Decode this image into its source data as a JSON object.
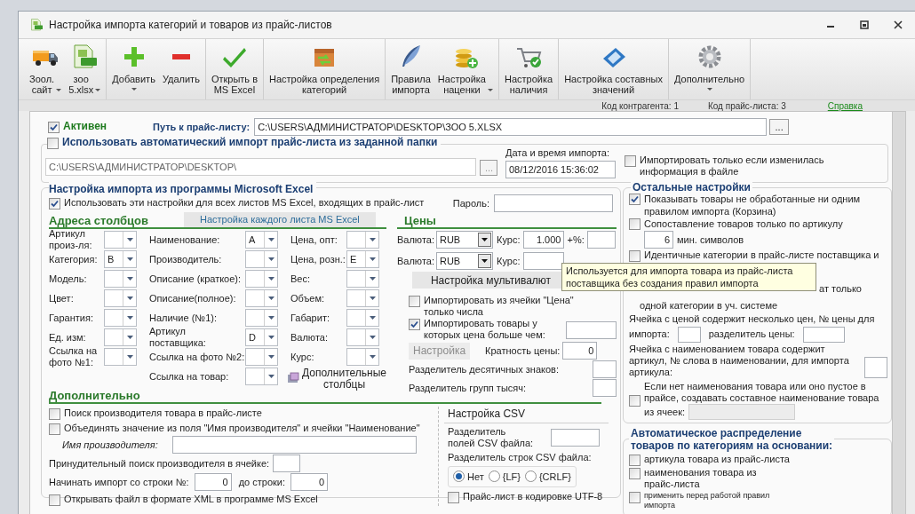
{
  "window": {
    "title": "Настройка импорта категорий и товаров из прайс-листов"
  },
  "toolbar": {
    "groups": [
      [
        {
          "kind": "truck",
          "label": "Зоол.\nсайт",
          "dropdown": true
        },
        {
          "kind": "xls",
          "label": "зоо\n5.xlsx",
          "dropdown": true
        }
      ],
      [
        {
          "kind": "plus",
          "label": "Добавить",
          "dropdown": true
        },
        {
          "kind": "minus",
          "label": "Удалить"
        }
      ],
      [
        {
          "kind": "check",
          "label": "Открыть в\nMS Excel"
        }
      ],
      [
        {
          "kind": "box",
          "label": "Настройка определения\nкатегорий"
        }
      ],
      [
        {
          "kind": "feather",
          "label": "Правила\nимпорта"
        },
        {
          "kind": "coins",
          "label": "Настройка\nнаценки",
          "dropdown": true
        }
      ],
      [
        {
          "kind": "cart",
          "label": "Настройка\nналичия"
        }
      ],
      [
        {
          "kind": "device",
          "label": "Настройка составных\nзначений"
        }
      ],
      [
        {
          "kind": "gear",
          "label": "Дополнительно",
          "dropdown": true
        }
      ]
    ]
  },
  "info": {
    "contractor_code": "Код контрагента: 1",
    "pricelist_code": "Код прайс-листа: 3",
    "help_link": "Справка"
  },
  "source": {
    "active": {
      "label": "Активен",
      "checked": true
    },
    "path_label": "Путь к прайс-листу:",
    "path": "C:\\USERS\\АДМИНИСТРАТОР\\DESKTOP\\ЗОО 5.XLSX",
    "browse": "...",
    "auto_import": {
      "label": "Использовать автоматический импорт прайс-листа из заданной папки",
      "checked": false
    },
    "folder": "C:\\USERS\\АДМИНИСТРАТОР\\DESKTOP\\",
    "folder_browse": "...",
    "date_label": "Дата и время импорта:",
    "date": "08/12/2016 15:36:02",
    "only_changed": {
      "label": "Импортировать только если изменилась информация в файле",
      "checked": false
    }
  },
  "excel": {
    "title": "Настройка импорта из программы Microsoft Excel",
    "use_all": {
      "label": "Использовать эти настройки для всех листов MS Excel, входящих в прайс-лист",
      "checked": true
    },
    "password_label": "Пароль:",
    "columns_heading": "Адреса столбцов",
    "sheet_button": "Настройка каждого листа MS Excel",
    "columns": [
      [
        {
          "label": "Артикул\nпроиз-ля:"
        },
        {
          "label": "Категория:",
          "value": "B"
        },
        {
          "label": "Модель:"
        },
        {
          "label": "Цвет:"
        },
        {
          "label": "Гарантия:"
        },
        {
          "label": "Ед. изм:"
        },
        {
          "label": "Ссылка на\nфото №1:"
        }
      ],
      [
        {
          "label": "Наименование:",
          "value": "A"
        },
        {
          "label": "Производитель:"
        },
        {
          "label": "Описание (краткое):"
        },
        {
          "label": "Описание(полное):"
        },
        {
          "label": "Наличие (№1):"
        },
        {
          "label": "Артикул\nпоставщика:",
          "value": "D"
        },
        {
          "label": "Ссылка на фото №2:"
        },
        {
          "label": "Ссылка на товар:"
        }
      ],
      [
        {
          "label": "Цена, опт:"
        },
        {
          "label": "Цена, розн.:",
          "value": "E"
        },
        {
          "label": "Вес:"
        },
        {
          "label": "Объем:"
        },
        {
          "label": "Габарит:"
        },
        {
          "label": "Валюта:"
        },
        {
          "label": "Курс:"
        }
      ]
    ],
    "extra_columns": "Дополнительные\nстолбцы",
    "prices": {
      "heading": "Цены",
      "currencies": [
        {
          "label": "Валюта:",
          "value": "RUB",
          "rate_label": "Курс:",
          "rate": "1.000",
          "markup_label": "+%:"
        },
        {
          "label": "Валюта:",
          "value": "RUB",
          "rate_label": "Курс:"
        }
      ],
      "multicurrency_button": "Настройка мультивалют",
      "numbers_only": {
        "label": "Импортировать из ячейки \"Цена\" только числа",
        "checked": false
      },
      "min_price": {
        "label": "Импортировать товары у которых цена больше чем:",
        "checked": true
      },
      "settings_button": {
        "label": "Настройка",
        "disabled": true
      },
      "multiplicity_label": "Кратность цены:",
      "multiplicity": "0",
      "decimal_separator_label": "Разделитель десятичных знаков:",
      "thousands_separator_label": "Разделитель групп тысяч:"
    }
  },
  "additional": {
    "heading": "Дополнительно",
    "find_manufacturer": {
      "label": "Поиск производителя товара в прайс-листе",
      "checked": false
    },
    "merge_name": {
      "label": "Объединять значение из поля \"Имя производителя\" и ячейки \"Наименование\"",
      "checked": false
    },
    "manufacturer_label": "Имя производителя:",
    "forced_search_label": "Принудительный поиск производителя в ячейке:",
    "start_row_label": "Начинать импорт со строки №:",
    "start_row": "0",
    "end_row_label": "до строки:",
    "end_row": "0",
    "open_xml": {
      "label": "Открывать файл в формате XML в программе MS Excel",
      "checked": false
    },
    "csv": {
      "heading": "Настройка CSV",
      "field_separator_label": "Разделитель\nполей CSV файла:",
      "row_separator_label": "Разделитель строк CSV файла:",
      "row_separators": [
        {
          "label": "Нет",
          "selected": true
        },
        {
          "label": "{LF}",
          "selected": false
        },
        {
          "label": "{CRLF}",
          "selected": false
        }
      ],
      "utf8": {
        "label": "Прайс-лист в кодировке UTF-8",
        "checked": false
      }
    }
  },
  "other": {
    "title": "Остальные настройки",
    "show_unprocessed": {
      "label": "Показывать товары не обработанные ни одним правилом импорта (Корзина)",
      "checked": true
    },
    "match_by_sku": {
      "label": "Сопоставление товаров только по артикулу",
      "checked": false
    },
    "min_chars": "6",
    "min_chars_label": "мин. символов",
    "identical_categories": {
      "label": "Идентичные категории в прайс-листе поставщика и",
      "checked": false,
      "fragments": [
        "ат только",
        "одной категории в уч. системе"
      ]
    },
    "multi_price_label": "Ячейка с ценой содержит несколько цен, № цены для",
    "multi_price_label_end": "импорта:",
    "price_separator_label": "разделитель цены:",
    "sku_in_name_label": "Ячейка с наименованием товара содержит артикул, № слова в наименовании, для импорта артикула:",
    "compose_name": {
      "label": "Если нет наименования товара или оно пустое в прайсе, создавать составное наименование товара",
      "checked": false
    },
    "cells_label": "из ячеек:"
  },
  "auto_distribution": {
    "title": "Автоматическое распределение\nтоваров по категориям на основании:",
    "items": [
      {
        "label": "артикула товара из прайс-листа",
        "checked": false,
        "kind": "normal"
      },
      {
        "label": "наименования товара из\nпрайс-листа",
        "checked": false,
        "kind": "normal"
      },
      {
        "label": "применить перед работой правил\nимпорта",
        "checked": false,
        "kind": "small"
      }
    ]
  },
  "tooltip": "Используется для импорта товара из прайс-листа\nпоставщика без создания правил импорта"
}
